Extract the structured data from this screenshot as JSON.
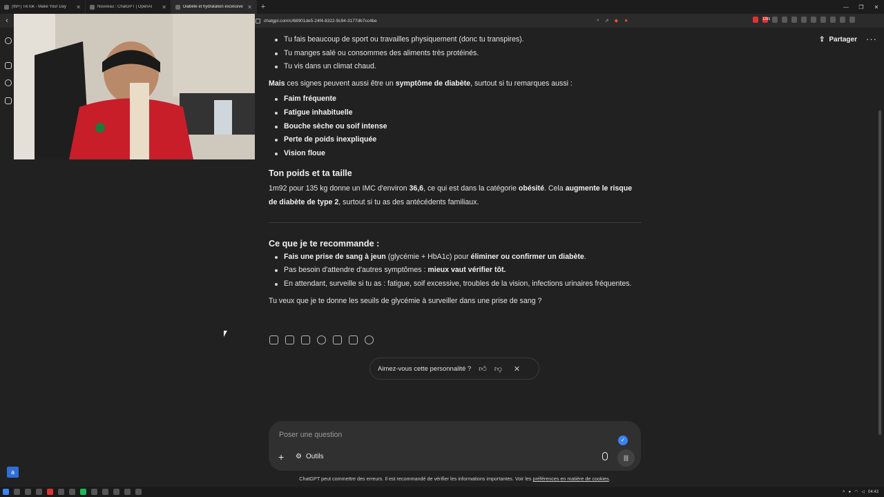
{
  "browser": {
    "tabs": [
      {
        "title": "(99+) TikTok - Make Your Day"
      },
      {
        "title": "Nouveau : ChatGPT | OpenAI"
      },
      {
        "title": "Diabète et hydratation excessive"
      }
    ],
    "url": "chatgpt.com/c/68901de5-24f4-8322-9c94-3177db7cc4be",
    "ext_badge": "1265",
    "clock": "04:43"
  },
  "header": {
    "share_label": "Partager",
    "more_label": "···"
  },
  "conversation": {
    "bullets1": [
      "Tu fais beaucoup de sport ou travailles physiquement (donc tu transpires).",
      "Tu manges salé ou consommes des aliments très protéinés.",
      "Tu vis dans un climat chaud."
    ],
    "para1": {
      "b1": "Mais",
      "t1": " ces signes peuvent aussi être un ",
      "b2": "symptôme de diabète",
      "t2": ", surtout si tu remarques aussi :"
    },
    "symptoms": [
      "Faim fréquente",
      "Fatigue inhabituelle",
      "Bouche sèche ou soif intense",
      "Perte de poids inexpliquée",
      "Vision floue"
    ],
    "heading1": "Ton poids et ta taille",
    "para2": {
      "t1": "1m92 pour 135 kg donne un IMC d'environ ",
      "b1": "36,6",
      "t2": ", ce qui est dans la catégorie ",
      "b2": "obésité",
      "t3": ". Cela ",
      "b3": "augmente le risque de diabète de type 2",
      "t4": ", surtout si tu as des antécédents familiaux."
    },
    "heading2": "Ce que je te recommande :",
    "rec1": {
      "b1": "Fais une prise de sang à jeun",
      "t1": " (glycémie + HbA1c) pour ",
      "b2": "éliminer ou confirmer un diabète",
      "t2": "."
    },
    "rec2": {
      "t1": "Pas besoin d'attendre d'autres symptômes : ",
      "b1": "mieux vaut vérifier tôt."
    },
    "rec3": "En attendant, surveille si tu as : fatigue, soif excessive, troubles de la vision, infections urinaires fréquentes.",
    "question": "Tu veux que je te donne les seuils de glycémie à surveiller dans une prise de sang ?"
  },
  "feedback": {
    "prompt": "Aimez-vous cette personnalité ?"
  },
  "composer": {
    "placeholder": "Poser une question",
    "plus_label": "+",
    "tools_label": "Outils"
  },
  "footer": {
    "disclaimer_prefix": "ChatGPT peut commettre des erreurs. Il est recommandé de vérifier les informations importantes. Voir les ",
    "disclaimer_link": "préférences en matière de cookies",
    "disclaimer_suffix": "."
  },
  "sidebar": {
    "lang_button": "a"
  }
}
